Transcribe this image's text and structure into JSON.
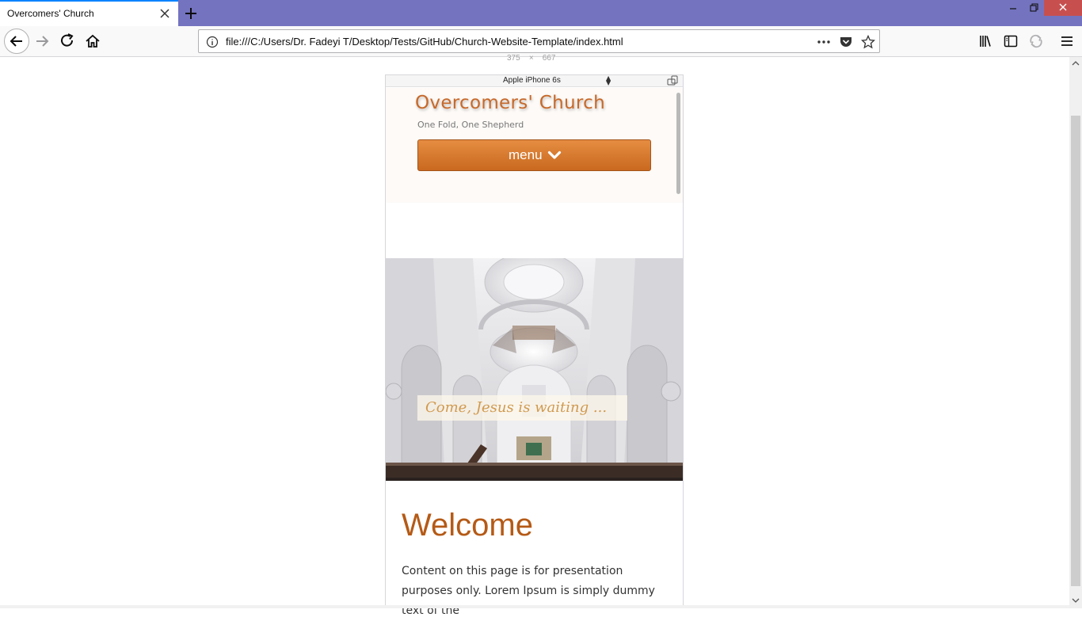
{
  "browser": {
    "tab_title": "Overcomers' Church",
    "url": "file:///C:/Users/Dr. Fadeyi T/Desktop/Tests/GitHub/Church-Website-Template/index.html",
    "accent_color": "#7473bf",
    "close_color": "#c7504f"
  },
  "responsive_mode": {
    "width": "375",
    "times": "×",
    "height": "667",
    "device": "Apple iPhone 6s"
  },
  "site": {
    "title": "Overcomers' Church",
    "tagline": "One Fold, One Shepherd",
    "menu_label": "menu",
    "hero_caption": "Come, Jesus is waiting ...",
    "welcome_heading": "Welcome",
    "intro_text": "Content on this page is for presentation purposes only. Lorem Ipsum is simply dummy text of the",
    "brand_color": "#c7692a",
    "heading_color": "#b55a16"
  },
  "icons": {
    "tab_close": "close-icon",
    "new_tab": "plus-icon",
    "back": "arrow-left-icon",
    "forward": "arrow-right-icon",
    "reload": "reload-icon",
    "home": "home-icon",
    "site_info": "info-icon",
    "page_actions": "ellipsis-icon",
    "pocket": "pocket-icon",
    "bookmark": "star-icon",
    "library": "library-icon",
    "sidebar": "sidebar-icon",
    "sync": "sync-icon",
    "app_menu": "hamburger-icon",
    "rotate": "rotate-device-icon",
    "menu_chevron": "chevron-down-icon"
  }
}
